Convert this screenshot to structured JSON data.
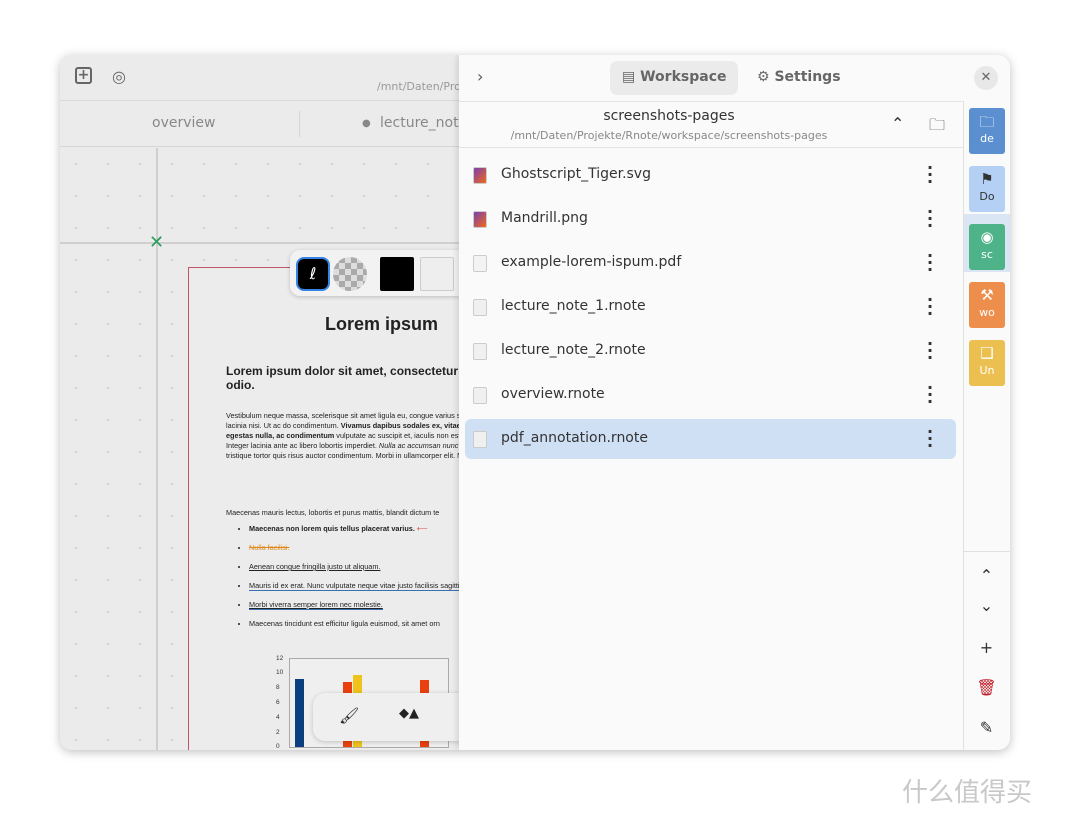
{
  "left_header": {
    "path_fragment": "/mnt/Daten/Pro"
  },
  "tabs": [
    {
      "label": "overview"
    },
    {
      "label": "lecture_note",
      "modified": true
    }
  ],
  "document": {
    "title": "Lorem ipsum",
    "subtitle": "Lorem ipsum dolor sit amet, consectetur elit. Nunc ac faucibus odio.",
    "para1_a": "Vestibulum neque massa, scelerisque sit amet ligula eu, congue varius sem. Nullam at porttitor arcu, nec lacinia nisi. Ut ac do condimentum. ",
    "para1_bold": "Vivamus dapibus sodales ex, vitae male convallis. Maecenas sed egestas nulla, ac condimentum",
    "para1_b": " vulputate ac suscipit et, iaculis non est. Curabitur semper arcu ac nisl blandit. Integer lacinia ante ac libero lobortis imperdiet. ",
    "para1_italic": "Nulla ac accumsan nunc vehicula vitae.",
    "para1_c": " Nulla eget justo in felis tristique tortor quis risus auctor condimentum. Morbi in ullamcorper elit. Nu mauris tempus fringilla.",
    "para2": "Maecenas mauris lectus, lobortis et purus mattis, blandit dictum te",
    "bullets": [
      "Maecenas non lorem quis tellus placerat varius.",
      "Nulla facilisi.",
      "Aenean congue fringilla justo ut aliquam.",
      "Mauris id ex erat. Nunc vulputate neque vitae justo facilisis sagittis.",
      "Morbi viverra semper lorem nec molestie.",
      "Maecenas tincidunt est efficitur ligula euismod, sit amet orn"
    ],
    "chart_yticks": [
      "12",
      "10",
      "8",
      "6",
      "4",
      "2",
      "0"
    ]
  },
  "right_header": {
    "workspace_label": "Workspace",
    "settings_label": "Settings"
  },
  "folder": {
    "name": "screenshots-pages",
    "path": "/mnt/Daten/Projekte/Rnote/workspace/screenshots-pages"
  },
  "files": [
    {
      "name": "Ghostscript_Tiger.svg",
      "type": "image"
    },
    {
      "name": "Mandrill.png",
      "type": "image"
    },
    {
      "name": "example-lorem-ispum.pdf",
      "type": "pdf"
    },
    {
      "name": "lecture_note_1.rnote",
      "type": "file"
    },
    {
      "name": "lecture_note_2.rnote",
      "type": "file"
    },
    {
      "name": "overview.rnote",
      "type": "file"
    },
    {
      "name": "pdf_annotation.rnote",
      "type": "file",
      "selected": true
    }
  ],
  "workspaces": [
    {
      "label": "de",
      "icon": "folder-icon",
      "color": "#5b8fd0"
    },
    {
      "label": "Do",
      "icon": "bookmark-icon",
      "color": "#b4d0f4"
    },
    {
      "label": "sc",
      "icon": "camera-icon",
      "color": "#4fb38a",
      "selected": true
    },
    {
      "label": "wo",
      "icon": "hammer-icon",
      "color": "#ee8e4c"
    },
    {
      "label": "Un",
      "icon": "book-icon",
      "color": "#ecc050"
    }
  ],
  "watermark": "什么值得买"
}
